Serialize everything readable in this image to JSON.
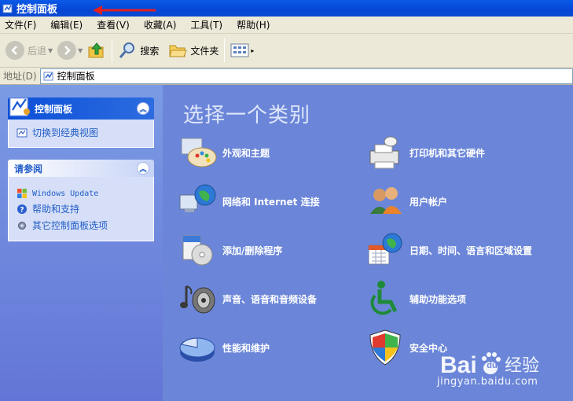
{
  "window": {
    "title": "控制面板"
  },
  "menubar": {
    "items": [
      "文件(F)",
      "编辑(E)",
      "查看(V)",
      "收藏(A)",
      "工具(T)",
      "帮助(H)"
    ]
  },
  "toolbar": {
    "back_label": "后退",
    "search_label": "搜索",
    "folders_label": "文件夹"
  },
  "address": {
    "label": "地址(D)",
    "value": "控制面板"
  },
  "sidebar": {
    "panel1": {
      "title": "控制面板",
      "link": "切换到经典视图"
    },
    "panel2": {
      "title": "请参阅",
      "links": [
        "Windows Update",
        "帮助和支持",
        "其它控制面板选项"
      ]
    }
  },
  "main": {
    "heading": "选择一个类别",
    "categories": [
      "外观和主题",
      "打印机和其它硬件",
      "网络和 Internet 连接",
      "用户帐户",
      "添加/删除程序",
      "日期、时间、语言和区域设置",
      "声音、语音和音频设备",
      "辅助功能选项",
      "性能和维护",
      "安全中心"
    ]
  },
  "watermark": {
    "text": "Bai 经验",
    "sub": "jingyan.baidu.com"
  },
  "colors": {
    "titlebar": "#0a5ae8",
    "pane": "#6b86d8",
    "link": "#215dc6",
    "arrow": "#e21f1f"
  }
}
